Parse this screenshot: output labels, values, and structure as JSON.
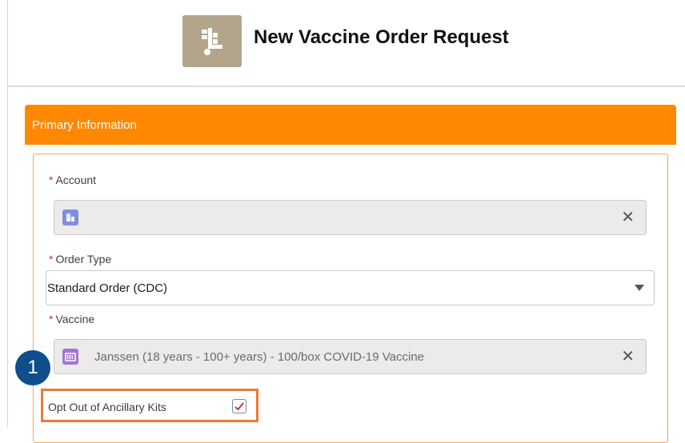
{
  "header": {
    "title": "New Vaccine Order Request",
    "icon": "dolly-icon",
    "icon_color": "#b3a58b"
  },
  "section": {
    "title": "Primary Information",
    "color": "#ff8800"
  },
  "fields": {
    "account": {
      "label": "Account",
      "required_marker": "*",
      "value": "",
      "icon": "account-icon"
    },
    "order_type": {
      "label": "Order Type",
      "required_marker": "*",
      "value": "Standard Order (CDC)"
    },
    "vaccine": {
      "label": "Vaccine",
      "required_marker": "*",
      "value": "Janssen (18 years - 100+ years) - 100/box COVID-19 Vaccine",
      "icon": "product-icon"
    },
    "opt_out": {
      "label": "Opt Out of Ancillary Kits",
      "checked": true
    }
  },
  "callout": {
    "number": "1",
    "color": "#0d4e8b",
    "highlight_color": "#ec7a34"
  },
  "clear_symbol": "✕"
}
